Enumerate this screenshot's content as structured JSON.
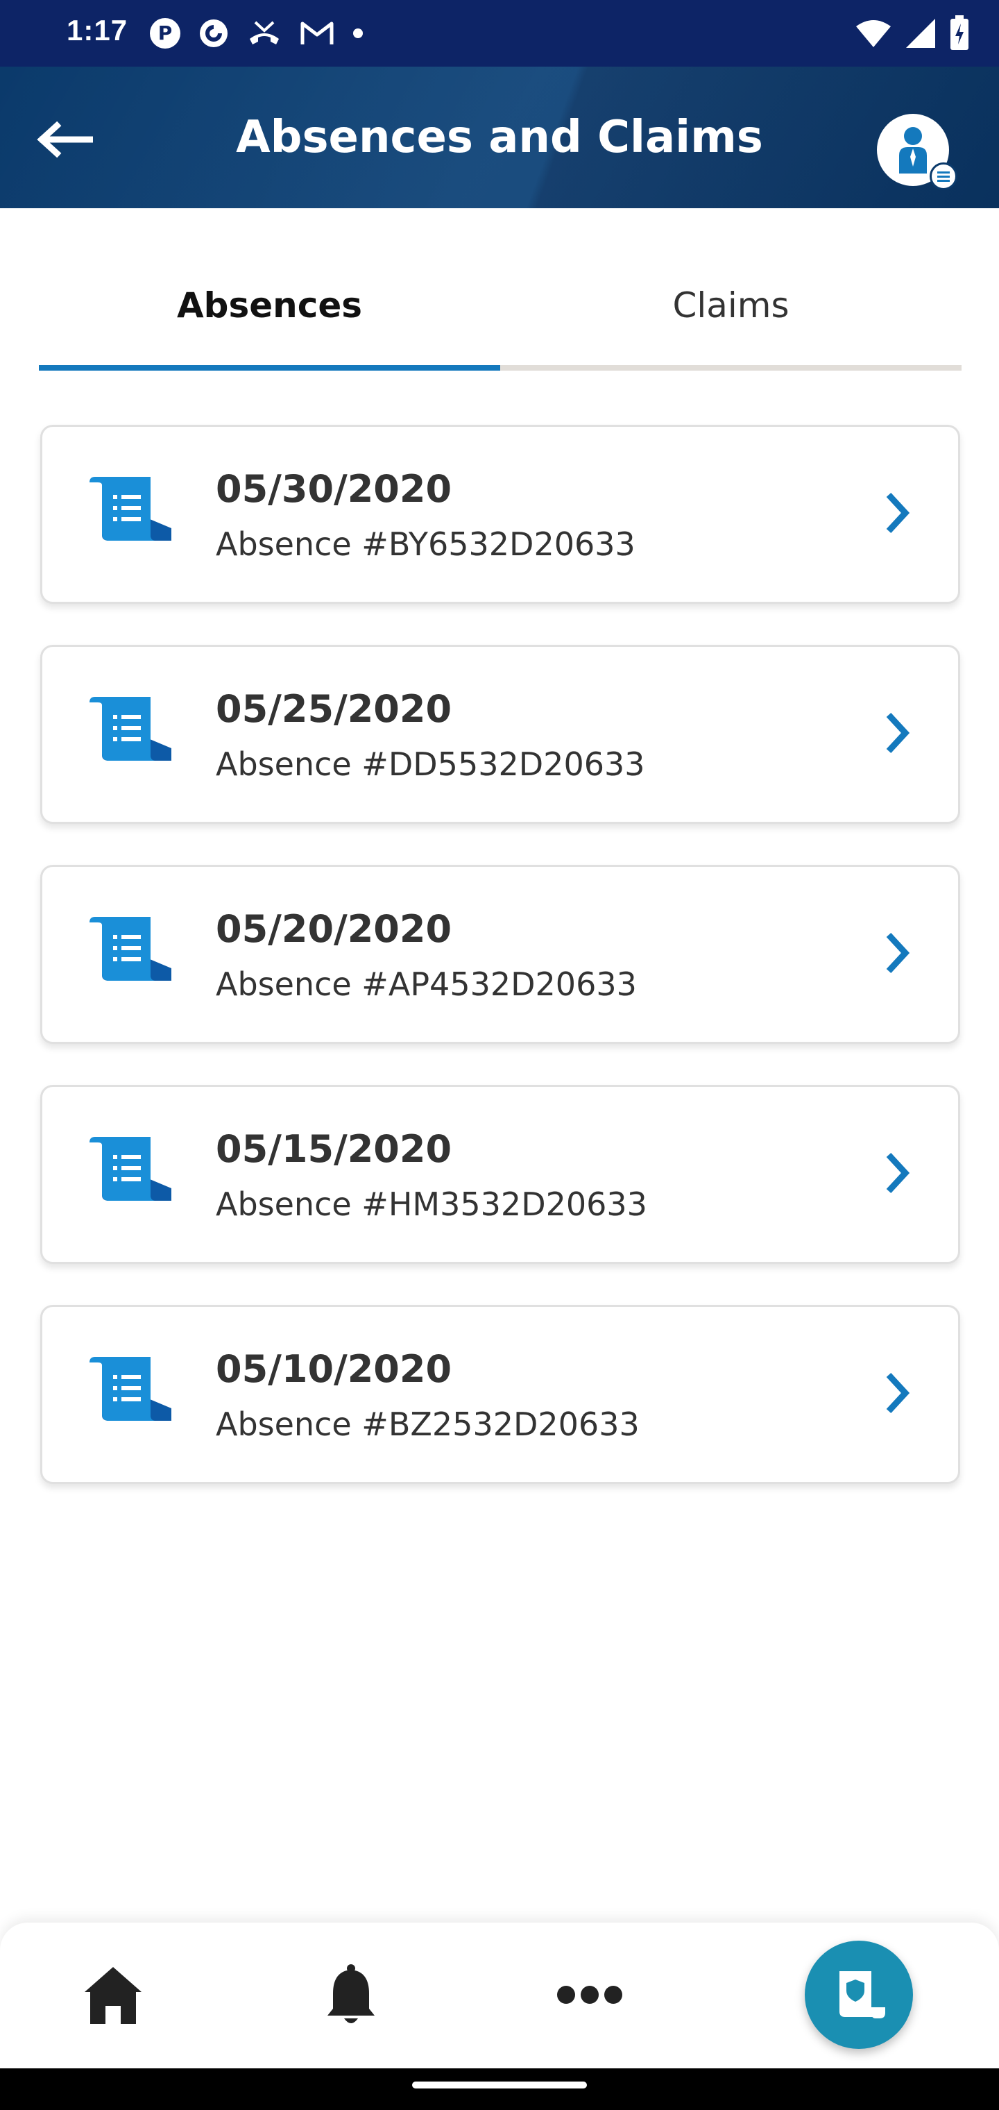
{
  "status_bar": {
    "time": "1:17",
    "left_icons": [
      "parking-app-icon",
      "pocket-casts-icon",
      "missed-call-icon",
      "gmail-icon",
      "dot-icon"
    ],
    "right_icons": [
      "wifi-icon",
      "cellular-signal-icon",
      "battery-icon"
    ]
  },
  "header": {
    "title": "Absences and Claims",
    "back_icon": "arrow-left-icon",
    "profile_icon": "profile-avatar-icon"
  },
  "tabs": [
    {
      "label": "Absences",
      "selected": true
    },
    {
      "label": "Claims",
      "selected": false
    }
  ],
  "absences": [
    {
      "date": "05/30/2020",
      "label": "Absence #BY6532D20633"
    },
    {
      "date": "05/25/2020",
      "label": "Absence #DD5532D20633"
    },
    {
      "date": "05/20/2020",
      "label": "Absence #AP4532D20633"
    },
    {
      "date": "05/15/2020",
      "label": "Absence #HM3532D20633"
    },
    {
      "date": "05/10/2020",
      "label": "Absence #BZ2532D20633"
    }
  ],
  "bottom_nav": {
    "items": [
      "home-icon",
      "bell-icon",
      "more-icon",
      "claims-fab-icon"
    ]
  },
  "colors": {
    "status_bar": "#0d2466",
    "header": "#0b3a6b",
    "accent": "#1479bd",
    "fab": "#1a8fb2",
    "text": "#333333"
  }
}
